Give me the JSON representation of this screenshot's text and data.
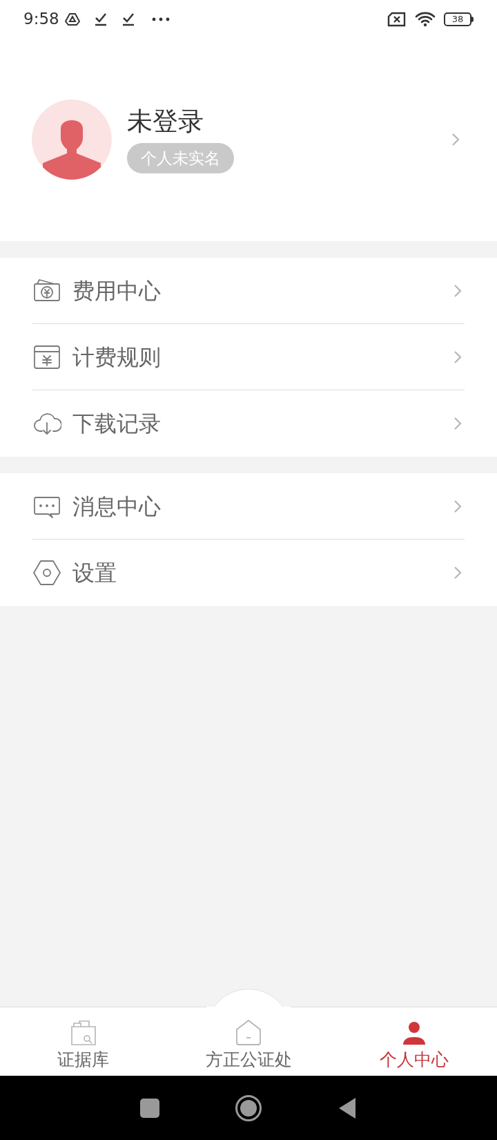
{
  "status_bar": {
    "time": "9:58",
    "battery": "38"
  },
  "profile": {
    "name": "未登录",
    "badge": "个人未实名"
  },
  "menu_groups": [
    {
      "items": [
        {
          "label": "费用中心",
          "kind": "wallet"
        },
        {
          "label": "计费规则",
          "kind": "bill"
        },
        {
          "label": "下载记录",
          "kind": "cloud"
        }
      ]
    },
    {
      "items": [
        {
          "label": "消息中心",
          "kind": "message"
        },
        {
          "label": "设置",
          "kind": "settings"
        }
      ]
    }
  ],
  "tabs": [
    {
      "label": "证据库",
      "kind": "evidence",
      "selected": false
    },
    {
      "label": "方正公证处",
      "kind": "home",
      "selected": false
    },
    {
      "label": "个人中心",
      "kind": "person",
      "selected": true
    }
  ]
}
